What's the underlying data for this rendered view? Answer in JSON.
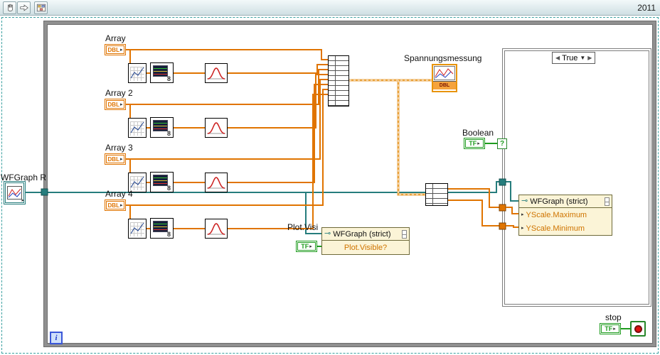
{
  "window": {
    "year_label": "2011"
  },
  "toolbar": {
    "icons": [
      "pan-hand",
      "select-arrow",
      "diagram-window"
    ]
  },
  "arrays": [
    {
      "label": "Array",
      "type": "DBL"
    },
    {
      "label": "Array 2",
      "type": "DBL"
    },
    {
      "label": "Array 3",
      "type": "DBL"
    },
    {
      "label": "Array 4",
      "type": "DBL"
    }
  ],
  "indicator": {
    "label": "Spannungsmessung",
    "type": "DBL"
  },
  "boolean_control": {
    "label": "Boolean",
    "type": "TF"
  },
  "wfgraph_ref": {
    "label": "WFGraph R"
  },
  "case_structure": {
    "selected_case": "True"
  },
  "case_property_node": {
    "header": "WFGraph (strict)",
    "rows": [
      "YScale.Maximum",
      "YScale.Minimum"
    ]
  },
  "plot_property_node": {
    "label": "Plot.Visi",
    "header": "WFGraph (strict)",
    "rows": [
      "Plot.Visible?"
    ],
    "type": "TF"
  },
  "stop_control": {
    "label": "stop",
    "type": "TF"
  },
  "loop": {
    "iteration_label": "i"
  },
  "glyphs": {
    "terminal_arrow": "▸",
    "scope_label": "8",
    "ref_glyph": "⊸",
    "row_arrow": "▸",
    "selector_prev": "◀",
    "selector_next": "▶",
    "selector_drop": "▼",
    "selector_terminal": "?"
  },
  "colors": {
    "dbl_orange": "#e07400",
    "bool_green": "#1f9c1f",
    "ref_teal": "#267d7d",
    "combined_wire": "#e8a23c",
    "loop_border": "#909090"
  }
}
